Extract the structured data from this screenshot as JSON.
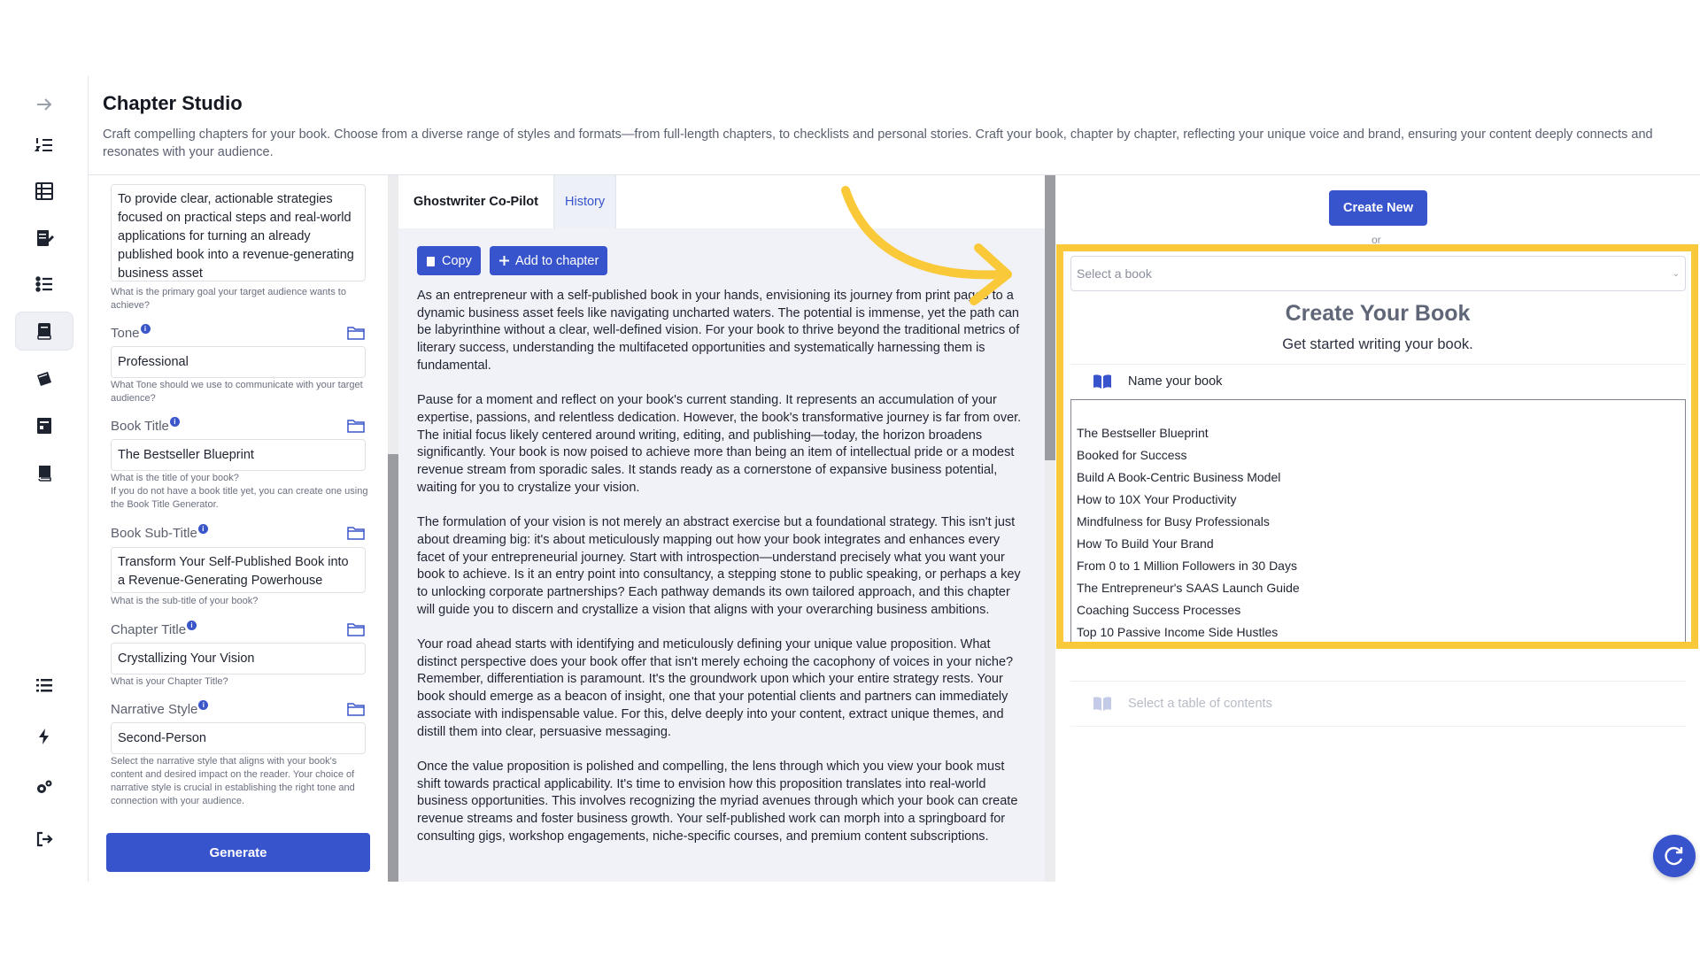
{
  "header": {
    "title": "Chapter Studio",
    "description": "Craft compelling chapters for your book. Choose from a diverse range of styles and formats—from full-length chapters, to checklists and personal stories. Craft your book, chapter by chapter, reflecting your unique voice and brand, ensuring your content deeply connects and resonates with your audience."
  },
  "sidebar": {
    "icons": [
      "arrow-right-icon",
      "numbered-list-icon",
      "table-icon",
      "edit-document-icon",
      "checklist-icon",
      "book-chapter-icon",
      "books-icon",
      "calendar-book-icon",
      "book-icon",
      "list-icon",
      "lightning-icon",
      "settings-icon",
      "logout-icon"
    ],
    "active": "book-chapter-icon"
  },
  "form": {
    "goal_value": "To provide clear, actionable strategies focused on practical steps and real-world applications for turning an already published book into a revenue-generating business asset",
    "goal_hint": "What is the primary goal your target audience wants to achieve?",
    "tone_label": "Tone",
    "tone_value": "Professional",
    "tone_hint": "What Tone should we use to communicate with your target audience?",
    "book_title_label": "Book Title",
    "book_title_value": "The Bestseller Blueprint",
    "book_title_hint": "What is the title of your book?\nIf you do not have a book title yet, you can create one using the Book Title Generator.",
    "subtitle_label": "Book Sub-Title",
    "subtitle_value": "Transform Your Self-Published Book into a Revenue-Generating Powerhouse",
    "subtitle_hint": "What is the sub-title of your book?",
    "chapter_title_label": "Chapter Title",
    "chapter_title_value": "Crystallizing Your Vision",
    "chapter_title_hint": "What is your Chapter Title?",
    "narrative_label": "Narrative Style",
    "narrative_value": "Second-Person",
    "narrative_hint": "Select the narrative style that aligns with your book's content and desired impact on the reader. Your choice of narrative style is crucial in establishing the right tone and connection with your audience.",
    "generate_label": "Generate"
  },
  "middle": {
    "tab_copilot": "Ghostwriter Co-Pilot",
    "tab_history": "History",
    "copy_label": "Copy",
    "add_label": "Add to chapter",
    "paragraphs": [
      "As an entrepreneur with a self-published book in your hands, envisioning its journey from print pages to a dynamic business asset feels like navigating uncharted waters. The potential is immense, yet the path can be labyrinthine without a clear, well-defined vision. For your book to thrive beyond the traditional metrics of literary success, understanding the multifaceted opportunities and systematically harnessing them is fundamental.",
      "Pause for a moment and reflect on your book's current standing. It represents an accumulation of your expertise, passions, and relentless dedication. However, the book's transformative journey is far from over. The initial focus likely centered around writing, editing, and publishing—today, the horizon broadens significantly. Your book is now poised to achieve more than being an item of intellectual pride or a modest revenue stream from sporadic sales. It stands ready as a cornerstone of expansive business potential, waiting for you to crystalize your vision.",
      "The formulation of your vision is not merely an abstract exercise but a foundational strategy. This isn't just about dreaming big: it's about meticulously mapping out how your book integrates and enhances every facet of your entrepreneurial journey. Start with introspection—understand precisely what you want your book to achieve. Is it an entry point into consultancy, a stepping stone to public speaking, or perhaps a key to unlocking corporate partnerships? Each pathway demands its own tailored approach, and this chapter will guide you to discern and crystallize a vision that aligns with your overarching business ambitions.",
      "Your road ahead starts with identifying and meticulously defining your unique value proposition. What distinct perspective does your book offer that isn't merely echoing the cacophony of voices in your niche? Remember, differentiation is paramount. It's the groundwork upon which your entire strategy rests. Your book should emerge as a beacon of insight, one that your potential clients and partners can immediately associate with indispensable value. For this, delve deeply into your content, extract unique themes, and distill them into clear, persuasive messaging.",
      "Once the value proposition is polished and compelling, the lens through which you view your book must shift towards practical applicability. It's time to envision how this proposition translates into real-world business opportunities. This involves recognizing the myriad avenues through which your book can create revenue streams and foster business growth. Your self-published work can morph into a springboard for consulting gigs, workshop engagements, niche-specific courses, and premium content subscriptions."
    ]
  },
  "right": {
    "create_new_label": "Create New",
    "or_text": "or",
    "select_placeholder": "Select a book",
    "title": "Create Your Book",
    "subtitle": "Get started writing your book.",
    "name_label": "Name your book",
    "books": [
      "The Bestseller Blueprint",
      "Booked for Success",
      "Build A Book-Centric Business Model",
      "How to 10X Your Productivity",
      "Mindfulness for Busy Professionals",
      "How To Build Your Brand",
      "From 0 to 1 Million Followers in 30 Days",
      "The Entrepreneur's SAAS Launch Guide",
      "Coaching Success Processes",
      "Top 10 Passive Income Side Hustles"
    ],
    "toc_label": "Select a table of contents"
  },
  "colors": {
    "accent": "#3754cc",
    "highlight": "#f9c93a"
  }
}
